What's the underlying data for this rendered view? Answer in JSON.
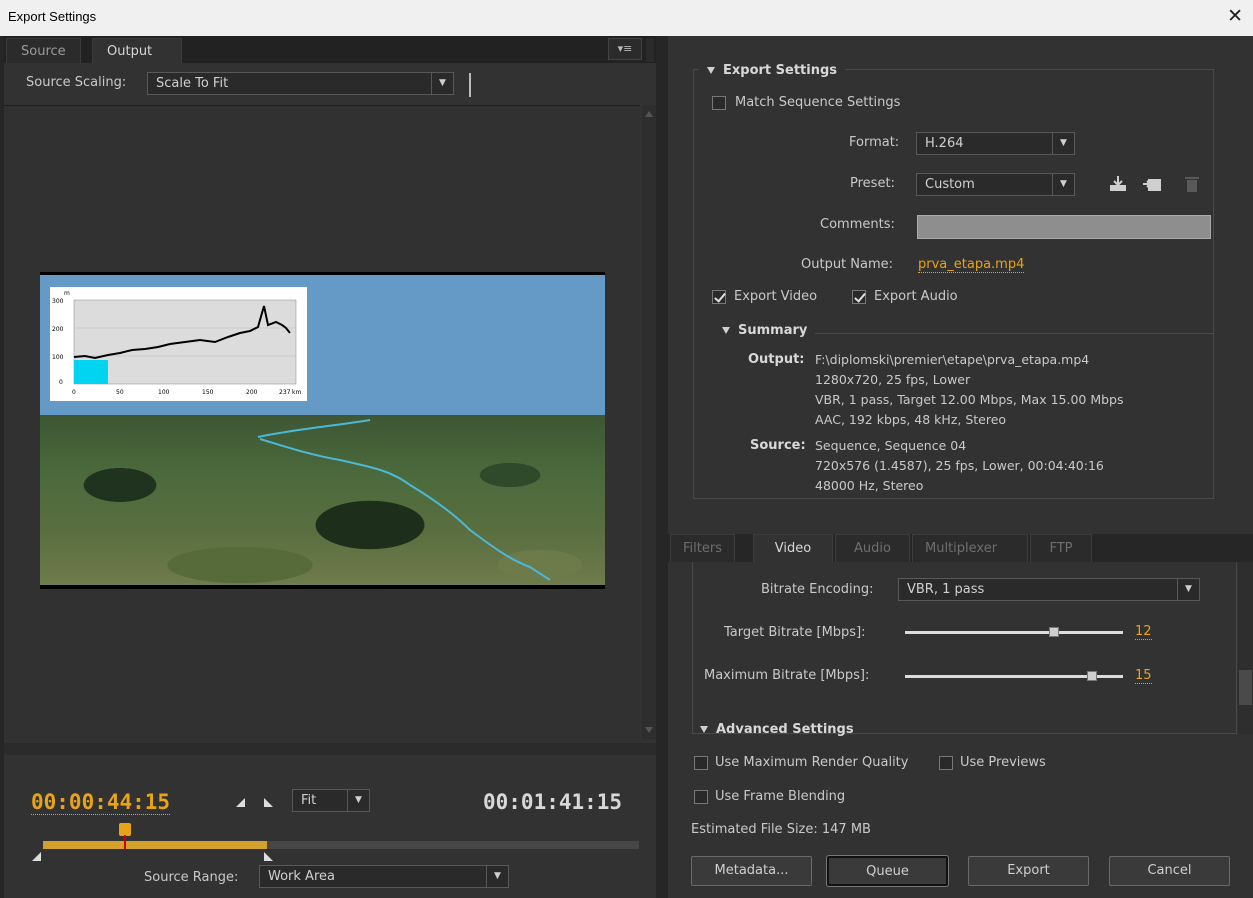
{
  "window": {
    "title": "Export Settings",
    "close_glyph": "✕"
  },
  "left": {
    "tabs": [
      {
        "label": "Source"
      },
      {
        "label": "Output"
      }
    ],
    "panel_menu_glyph": "▾≡",
    "source_scaling": {
      "label": "Source Scaling:",
      "value": "Scale To Fit"
    },
    "inset_chart": {
      "y_unit": "m",
      "y_ticks": [
        "300",
        "200",
        "100",
        "0"
      ],
      "x_ticks": [
        "0",
        "50",
        "100",
        "150",
        "200",
        "237"
      ],
      "x_unit": "km"
    },
    "timeline": {
      "current": "00:00:44:15",
      "total": "00:01:41:15",
      "zoom": "Fit",
      "source_range_label": "Source Range:",
      "source_range_value": "Work Area",
      "work_area_fraction": 0.375,
      "playhead_fraction": 0.138
    }
  },
  "right": {
    "export_settings": {
      "title": "Export Settings",
      "match_sequence_label": "Match Sequence Settings",
      "format_label": "Format:",
      "format_value": "H.264",
      "preset_label": "Preset:",
      "preset_value": "Custom",
      "comments_label": "Comments:",
      "output_name_label": "Output Name:",
      "output_name_value": "prva_etapa.mp4",
      "export_video_label": "Export Video",
      "export_audio_label": "Export Audio"
    },
    "summary": {
      "title": "Summary",
      "output_label": "Output:",
      "output_lines": [
        "F:\\diplomski\\premier\\etape\\prva_etapa.mp4",
        "1280x720, 25 fps, Lower",
        "VBR, 1 pass, Target 12.00 Mbps, Max 15.00 Mbps",
        "AAC, 192 kbps, 48 kHz, Stereo"
      ],
      "source_label": "Source:",
      "source_lines": [
        "Sequence, Sequence 04",
        "720x576 (1.4587), 25 fps, Lower, 00:04:40:16",
        "48000 Hz, Stereo"
      ]
    },
    "tabs": [
      {
        "label": "Filters"
      },
      {
        "label": "Video"
      },
      {
        "label": "Audio"
      },
      {
        "label": "Multiplexer"
      },
      {
        "label": "FTP"
      }
    ],
    "video": {
      "bitrate_encoding_label": "Bitrate Encoding:",
      "bitrate_encoding_value": "VBR, 1 pass",
      "target_label": "Target Bitrate [Mbps]:",
      "target_value": "12",
      "max_label": "Maximum Bitrate [Mbps]:",
      "max_value": "15",
      "advanced_title": "Advanced Settings"
    },
    "options": {
      "max_render_quality": "Use Maximum Render Quality",
      "use_previews": "Use Previews",
      "frame_blending": "Use Frame Blending"
    },
    "file_size": "Estimated File Size:  147 MB",
    "buttons": {
      "metadata": "Metadata...",
      "queue": "Queue",
      "export": "Export",
      "cancel": "Cancel"
    }
  }
}
